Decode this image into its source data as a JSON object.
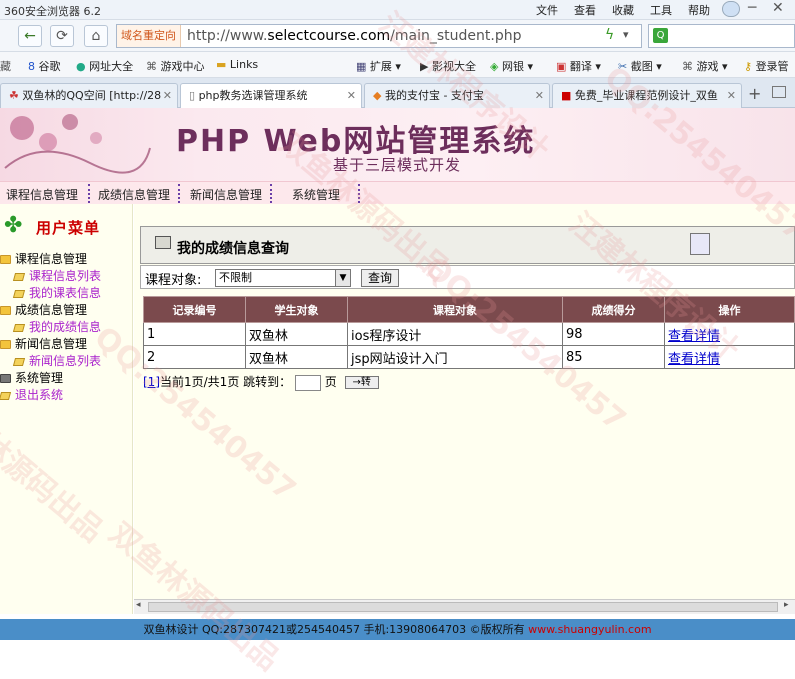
{
  "browser": {
    "title": "360安全浏览器 6.2",
    "menu": [
      "文件",
      "查看",
      "收藏",
      "工具",
      "帮助"
    ],
    "redirect_label": "域名重定向",
    "url_prefix": "http://www.",
    "url_host": "selectcourse.com",
    "url_path": "/main_student.php",
    "bookmarks": [
      "谷歌",
      "网址大全",
      "游戏中心",
      "Links",
      "扩展",
      "影视大全",
      "网银",
      "翻译",
      "截图",
      "游戏",
      "登录管"
    ],
    "tabs": [
      {
        "label": "双鱼林的QQ空间 [http://28",
        "active": false
      },
      {
        "label": "php教务选课管理系统",
        "active": true
      },
      {
        "label": "我的支付宝 - 支付宝",
        "active": false
      },
      {
        "label": "免费_毕业课程范例设计_双鱼",
        "active": false
      }
    ]
  },
  "header": {
    "title": "PHP Web网站管理系统",
    "subtitle": "基于三层模式开发"
  },
  "topnav": [
    "课程信息管理",
    "成绩信息管理",
    "新闻信息管理",
    "系统管理"
  ],
  "sidebar": {
    "heading": "用户菜单",
    "groups": [
      {
        "label": "课程信息管理",
        "children": [
          "课程信息列表",
          "我的课表信息"
        ]
      },
      {
        "label": "成绩信息管理",
        "children": [
          "我的成绩信息"
        ]
      },
      {
        "label": "新闻信息管理",
        "children": [
          "新闻信息列表"
        ]
      },
      {
        "label": "系统管理",
        "children": [
          "退出系统"
        ]
      }
    ]
  },
  "panel": {
    "title": "我的成绩信息查询"
  },
  "filter": {
    "label": "课程对象:",
    "selected": "不限制",
    "query_button": "查询"
  },
  "table": {
    "columns": [
      "记录编号",
      "学生对象",
      "课程对象",
      "成绩得分",
      "操作"
    ],
    "rows": [
      [
        "1",
        "双鱼林",
        "ios程序设计",
        "98",
        "查看详情"
      ],
      [
        "2",
        "双鱼林",
        "jsp网站设计入门",
        "85",
        "查看详情"
      ]
    ]
  },
  "pager": {
    "page_link": "[1]",
    "info": "当前1页/共1页 跳转到：",
    "unit": "页",
    "go_button": "→转"
  },
  "footer": {
    "text": "双鱼林设计 QQ:287307421或254540457 手机:13908064703 ©版权所有",
    "link": "www.shuangyulin.com"
  },
  "watermarks": [
    "汪建林程序设计",
    "QQ:254540457",
    "双鱼林源码出品",
    "QQ:254540457",
    "汪建林程序设计",
    "林源码出品",
    "QQ:254540457",
    "双鱼林源码出品"
  ]
}
